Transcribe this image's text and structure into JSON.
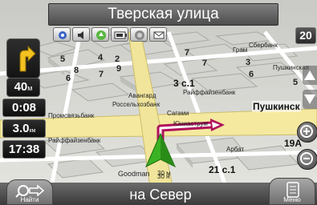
{
  "street_name": "Тверская улица",
  "toolbar": [
    "satellites-icon",
    "sound-icon",
    "traffic-icon",
    "battery-icon",
    "online-icon",
    "messages-icon"
  ],
  "next_turn": {
    "icon": "turn-right-icon",
    "distance": "40",
    "unit": "м"
  },
  "trip": {
    "time_to_go": "0:08",
    "distance": "3.0",
    "distance_unit": "км",
    "arrival": "17:38"
  },
  "scale": "20",
  "direction": "на Север",
  "find_button": {
    "label": "Найти",
    "icon": "search-arrow-icon"
  },
  "menu_button": {
    "label": "Меню",
    "icon": "menu-icon"
  },
  "map_labels": {
    "b5a": "5",
    "b4": "4",
    "b2": "2",
    "b9": "9",
    "b6": "6",
    "b8": "8",
    "b7a": "7",
    "b7b": "7",
    "b7c": "7",
    "b3": "3",
    "b6b": "6",
    "b5b": "5",
    "b3c1": "3 с.1",
    "b21c1": "21 с.1",
    "b19a": "19А",
    "raif1": "Райффайзенбанк",
    "raif2": "Райффайзенбанк",
    "prom": "Промсвязьбанк",
    "avan": "Авангард",
    "ross": "Россельхозбанк",
    "sberb": "Сбербанк",
    "gram": "Грам",
    "pushkin_place": "Пушкинская",
    "pushkin_street": "Пушкинск",
    "sagami": "Сагами",
    "uniastr": "Юниаструм",
    "goodman": "Goodman",
    "road30a": "30 м",
    "road30b": "30 н",
    "arbat": "Арбат"
  },
  "colors": {
    "route": "#b0105a",
    "street": "#f3e79b",
    "arrow": "#3bb223"
  }
}
